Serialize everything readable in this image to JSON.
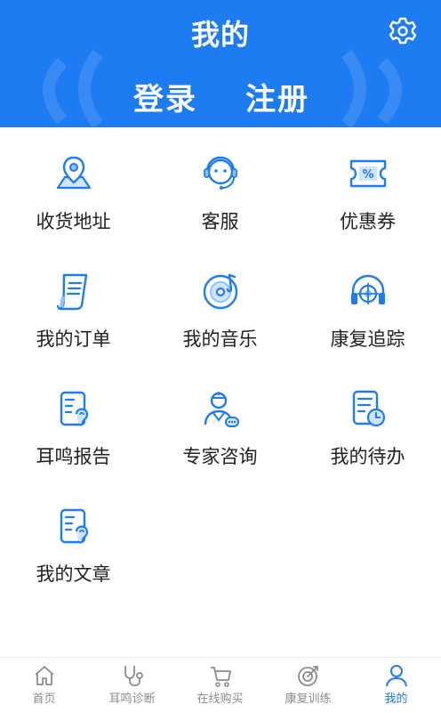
{
  "header": {
    "title": "我的",
    "login_label": "登录",
    "register_label": "注册",
    "settings_icon": "gear-icon",
    "background": "#1e7cf2"
  },
  "menu": [
    {
      "label": "收货地址",
      "icon": "location-map-icon"
    },
    {
      "label": "客服",
      "icon": "customer-service-icon"
    },
    {
      "label": "优惠券",
      "icon": "coupon-icon"
    },
    {
      "label": "我的订单",
      "icon": "order-receipt-icon"
    },
    {
      "label": "我的音乐",
      "icon": "music-disc-icon"
    },
    {
      "label": "康复追踪",
      "icon": "headphone-target-icon"
    },
    {
      "label": "耳鸣报告",
      "icon": "ear-report-icon"
    },
    {
      "label": "专家咨询",
      "icon": "doctor-consult-icon"
    },
    {
      "label": "我的待办",
      "icon": "todo-clock-icon"
    },
    {
      "label": "我的文章",
      "icon": "ear-article-icon"
    }
  ],
  "tabbar": [
    {
      "label": "首页",
      "icon": "home-icon",
      "active": false
    },
    {
      "label": "耳鸣诊断",
      "icon": "stethoscope-icon",
      "active": false
    },
    {
      "label": "在线购买",
      "icon": "cart-icon",
      "active": false
    },
    {
      "label": "康复训练",
      "icon": "training-target-icon",
      "active": false
    },
    {
      "label": "我的",
      "icon": "user-icon",
      "active": true
    }
  ],
  "colors": {
    "accent": "#1e7cf2",
    "tab_inactive": "#8c8c8c",
    "icon_light": "#8ec3ff"
  }
}
